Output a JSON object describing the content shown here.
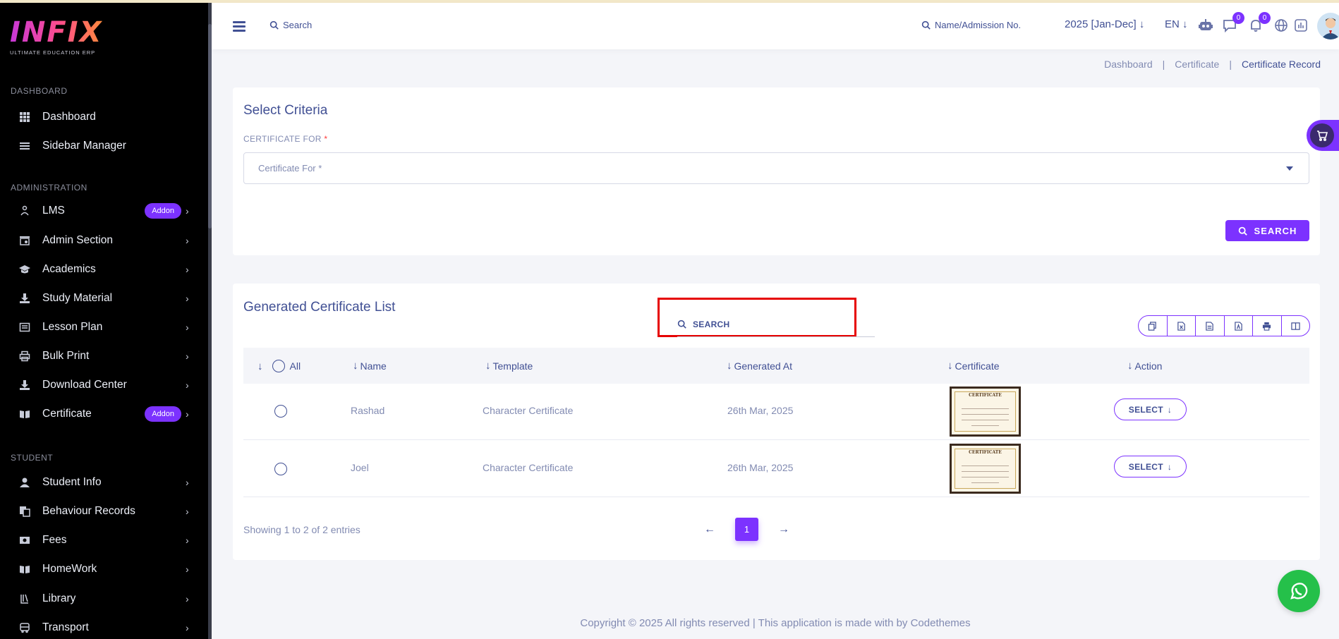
{
  "brand": {
    "logo": "INFIX",
    "tagline": "ULTIMATE EDUCATION ERP"
  },
  "sidebar": {
    "sections": [
      "DASHBOARD",
      "ADMINISTRATION",
      "STUDENT"
    ],
    "items": [
      {
        "label": "Dashboard",
        "icon": "grid-icon"
      },
      {
        "label": "Sidebar Manager",
        "icon": "list-icon"
      },
      {
        "label": "LMS",
        "icon": "lms-icon",
        "badge": "Addon"
      },
      {
        "label": "Admin Section",
        "icon": "admin-icon"
      },
      {
        "label": "Academics",
        "icon": "graduation-cap-icon"
      },
      {
        "label": "Study Material",
        "icon": "download-icon"
      },
      {
        "label": "Lesson Plan",
        "icon": "lesson-icon"
      },
      {
        "label": "Bulk Print",
        "icon": "printer-icon"
      },
      {
        "label": "Download Center",
        "icon": "download-center-icon"
      },
      {
        "label": "Certificate",
        "icon": "book-open-icon",
        "badge": "Addon"
      },
      {
        "label": "Student Info",
        "icon": "user-icon"
      },
      {
        "label": "Behaviour Records",
        "icon": "behaviour-icon"
      },
      {
        "label": "Fees",
        "icon": "money-icon"
      },
      {
        "label": "HomeWork",
        "icon": "book-icon"
      },
      {
        "label": "Library",
        "icon": "library-icon"
      },
      {
        "label": "Transport",
        "icon": "bus-icon"
      }
    ]
  },
  "header": {
    "search_label": "Search",
    "admission_label": "Name/Admission No.",
    "year": "2025 [Jan-Dec]",
    "lang": "EN",
    "chat_count": "0",
    "notif_count": "0"
  },
  "breadcrumb": {
    "items": [
      "Dashboard",
      "Certificate",
      "Certificate Record"
    ],
    "separator": "|"
  },
  "criteria": {
    "title": "Select Criteria",
    "field_label": "CERTIFICATE FOR",
    "required_mark": "*",
    "placeholder": "Certificate For *",
    "search_button": "SEARCH"
  },
  "list": {
    "title": "Generated Certificate List",
    "search_label": "SEARCH",
    "columns": [
      "All",
      "Name",
      "Template",
      "Generated At",
      "Certificate",
      "Action"
    ],
    "rows": [
      {
        "name": "Rashad",
        "template": "Character Certificate",
        "generated_at": "26th Mar, 2025",
        "action": "SELECT"
      },
      {
        "name": "Joel",
        "template": "Character Certificate",
        "generated_at": "26th Mar, 2025",
        "action": "SELECT"
      }
    ],
    "thumb_title": "CERTIFICATE",
    "showing": "Showing 1 to 2 of 2 entries",
    "current_page": "1"
  },
  "footer": {
    "text": "Copyright © 2025 All rights reserved | This application is made with by Codethemes"
  },
  "colors": {
    "accent": "#7c32ff",
    "text": "#415094",
    "muted": "#828bb2",
    "sidebar_bg": "#000000",
    "highlight": "#e60000",
    "whatsapp": "#25c04a"
  }
}
